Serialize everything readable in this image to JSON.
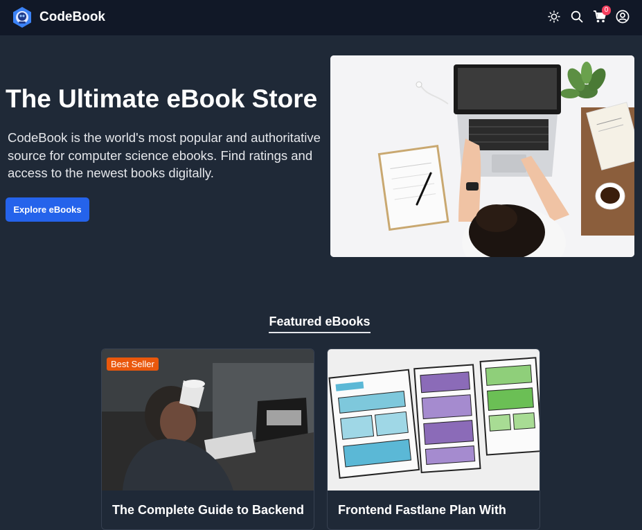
{
  "navbar": {
    "brand": "CodeBook",
    "icons": [
      "sun-icon",
      "search-icon",
      "cart-icon",
      "user-icon"
    ],
    "cart_count": "0"
  },
  "hero": {
    "title": "The Ultimate eBook Store",
    "description": "CodeBook is the world's most popular and authoritative source for computer science ebooks. Find ratings and access to the newest books digitally.",
    "cta_label": "Explore eBooks"
  },
  "featured": {
    "title": "Featured eBooks",
    "cards": [
      {
        "badge": "Best Seller",
        "title": "The Complete Guide to Backend"
      },
      {
        "title": "Frontend Fastlane Plan With"
      }
    ]
  },
  "colors": {
    "background": "#1f2937",
    "navbar": "#111827",
    "primary_button": "#2563eb",
    "badge": "#ea580c",
    "cart_badge": "#f43f5e"
  }
}
